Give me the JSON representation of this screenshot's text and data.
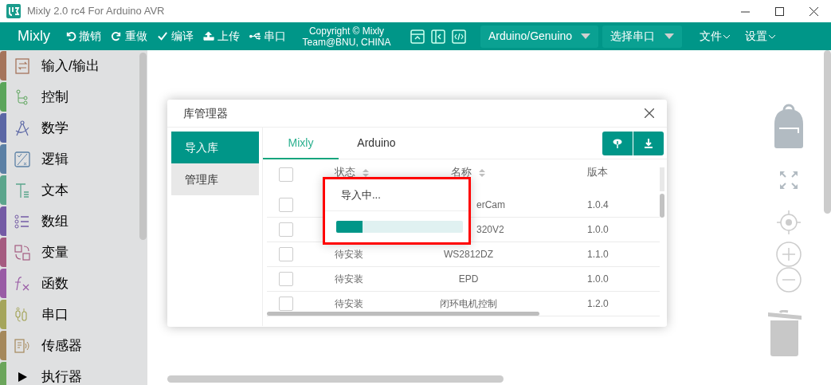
{
  "window": {
    "title": "Mixly 2.0 rc4 For Arduino AVR"
  },
  "toolbar": {
    "brand": "Mixly",
    "actions": [
      {
        "label": "撤销"
      },
      {
        "label": "重做"
      },
      {
        "label": "编译"
      },
      {
        "label": "上传"
      },
      {
        "label": "串口"
      }
    ],
    "copyright": [
      "Copyright © Mixly",
      "Team@BNU, CHINA"
    ],
    "board": "Arduino/Genuino",
    "port": "选择串口",
    "menus": [
      {
        "label": "文件"
      },
      {
        "label": "设置"
      }
    ]
  },
  "categories": [
    {
      "label": "输入/输出",
      "color": "#a5745b"
    },
    {
      "label": "控制",
      "color": "#5ba55b"
    },
    {
      "label": "数学",
      "color": "#5b67a5"
    },
    {
      "label": "逻辑",
      "color": "#5b80a5"
    },
    {
      "label": "文本",
      "color": "#5ba58c"
    },
    {
      "label": "数组",
      "color": "#745ba5"
    },
    {
      "label": "变量",
      "color": "#a55b80"
    },
    {
      "label": "函数",
      "color": "#995ba5"
    },
    {
      "label": "串口",
      "color": "#a5a55b"
    },
    {
      "label": "传感器",
      "color": "#a5885b"
    },
    {
      "label": "执行器",
      "color": "#6ba55b"
    }
  ],
  "dialog": {
    "title": "库管理器",
    "menu": [
      {
        "label": "导入库",
        "selected": true
      },
      {
        "label": "管理库",
        "selected": false
      }
    ],
    "tabs": [
      {
        "label": "Mixly",
        "selected": true
      },
      {
        "label": "Arduino",
        "selected": false
      }
    ],
    "select_all_checked": false,
    "columns": [
      "状态",
      "名称",
      "版本"
    ],
    "rows": [
      {
        "checked": false,
        "name": "erCam",
        "version": "1.0.4"
      },
      {
        "checked": false,
        "name": "320V2",
        "version": "1.0.0"
      },
      {
        "checked": false,
        "status": "待安装",
        "name": "WS2812DZ",
        "version": "1.1.0"
      },
      {
        "checked": false,
        "status": "待安装",
        "name": "EPD",
        "version": "1.0.0"
      },
      {
        "checked": false,
        "status": "待安装",
        "name": "闭环电机控制",
        "version": "1.2.0"
      }
    ],
    "progress": {
      "label": "导入中...",
      "level": 0.21
    }
  }
}
